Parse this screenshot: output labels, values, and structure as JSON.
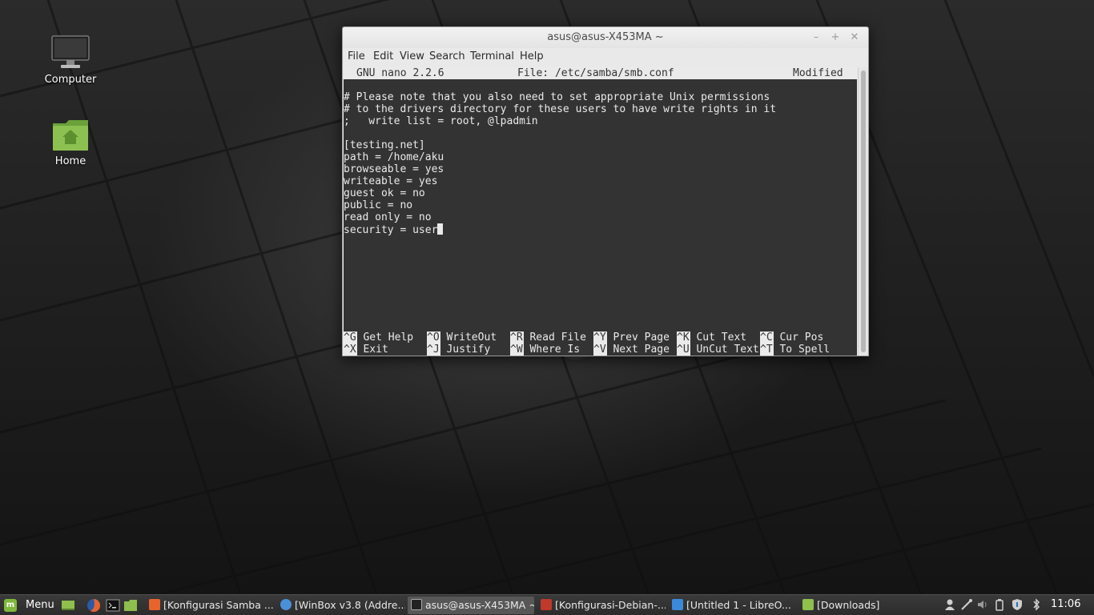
{
  "desktop": {
    "icons": [
      {
        "label": "Computer"
      },
      {
        "label": "Home"
      }
    ]
  },
  "window": {
    "title": "asus@asus-X453MA ~",
    "controls": {
      "minimize": "–",
      "maximize": "+",
      "close": "✕"
    },
    "menu": [
      "File",
      "Edit",
      "View",
      "Search",
      "Terminal",
      "Help"
    ]
  },
  "nano": {
    "version": "GNU nano 2.2.6",
    "file": "File: /etc/samba/smb.conf",
    "status": "Modified",
    "lines": [
      "",
      "# Please note that you also need to set appropriate Unix permissions",
      "# to the drivers directory for these users to have write rights in it",
      ";   write list = root, @lpadmin",
      "",
      "[testing.net]",
      "path = /home/aku",
      "browseable = yes",
      "writeable = yes",
      "guest ok = no",
      "public = no",
      "read only = no",
      "security = user"
    ],
    "shortcuts": [
      [
        {
          "key": "^G",
          "label": "Get Help"
        },
        {
          "key": "^O",
          "label": "WriteOut"
        },
        {
          "key": "^R",
          "label": "Read File"
        },
        {
          "key": "^Y",
          "label": "Prev Page"
        },
        {
          "key": "^K",
          "label": "Cut Text"
        },
        {
          "key": "^C",
          "label": "Cur Pos"
        }
      ],
      [
        {
          "key": "^X",
          "label": "Exit"
        },
        {
          "key": "^J",
          "label": "Justify"
        },
        {
          "key": "^W",
          "label": "Where Is"
        },
        {
          "key": "^V",
          "label": "Next Page"
        },
        {
          "key": "^U",
          "label": "UnCut Text"
        },
        {
          "key": "^T",
          "label": "To Spell"
        }
      ]
    ]
  },
  "panel": {
    "menu_label": "Menu",
    "tasks": [
      {
        "label": "[Konfigurasi Samba ...",
        "icon": "firefox-icon",
        "color": "#e8642c"
      },
      {
        "label": "[WinBox v3.8 (Addre...",
        "icon": "winbox-icon",
        "color": "#4a90d9"
      },
      {
        "label": "asus@asus-X453MA ~",
        "icon": "terminal-icon",
        "color": "#222222",
        "active": true
      },
      {
        "label": "[Konfigurasi-Debian-...",
        "icon": "document-viewer-icon",
        "color": "#c0392b"
      },
      {
        "label": "[Untitled 1 - LibreO...",
        "icon": "libreoffice-icon",
        "color": "#3b8ad9"
      },
      {
        "label": "[Downloads]",
        "icon": "folder-icon",
        "color": "#8fbf4d"
      }
    ],
    "clock": "11:06"
  }
}
